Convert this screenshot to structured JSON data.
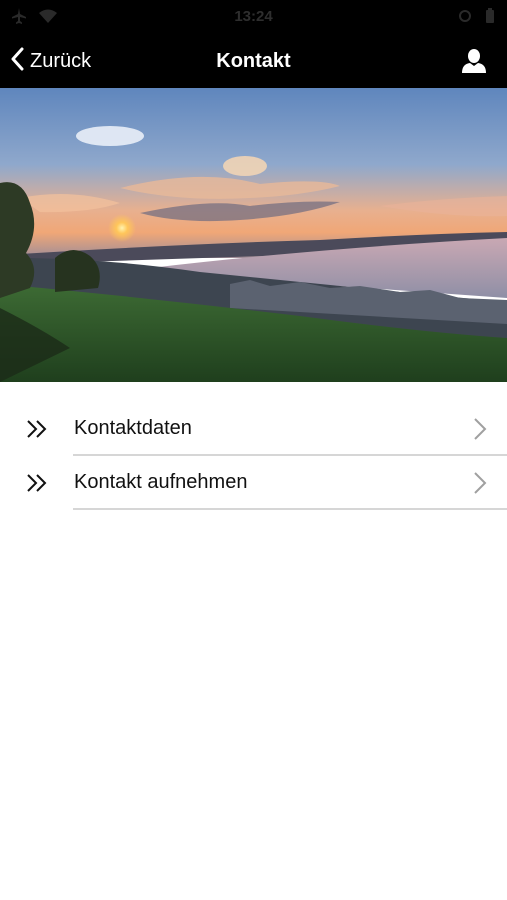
{
  "status_bar": {
    "time": "13:24",
    "left_icons": [
      "airplane-icon",
      "wifi-icon"
    ],
    "right_icons": [
      "alarm-icon",
      "battery-icon"
    ]
  },
  "nav": {
    "back_label": "Zurück",
    "back_icon": "chevron-left-icon",
    "title": "Kontakt",
    "profile_icon": "user-icon"
  },
  "hero": {
    "description_icon": "lake-sunset-photo"
  },
  "menu": {
    "items": [
      {
        "label": "Kontaktdaten",
        "lead_icon": "double-chevron-right-icon",
        "trail_icon": "chevron-right-icon"
      },
      {
        "label": "Kontakt aufnehmen",
        "lead_icon": "double-chevron-right-icon",
        "trail_icon": "chevron-right-icon"
      }
    ]
  },
  "colors": {
    "bar_background": "#000000",
    "bar_text": "#ffffff",
    "divider": "#d6d6d6",
    "chevron": "#a0a0a0"
  }
}
